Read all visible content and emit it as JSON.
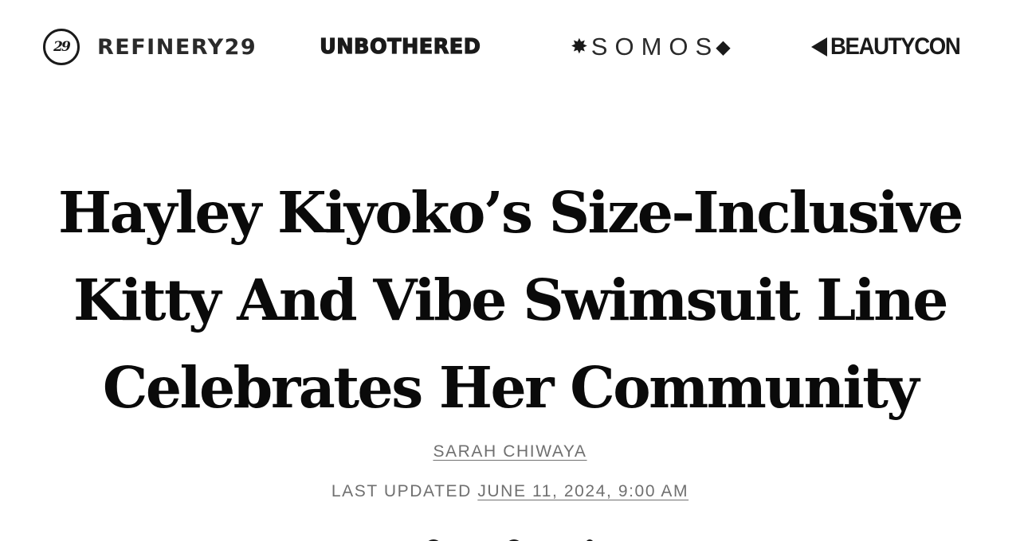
{
  "brands": {
    "refinery29": {
      "logo_text": "29",
      "name": "REFINERY29"
    },
    "unbothered": {
      "name": "UNBOTHERED"
    },
    "somos": {
      "name": "SOMOS"
    },
    "beautycon": {
      "name": "BEAUTYCON"
    }
  },
  "article": {
    "title_lines": [
      "Hayley Kiyoko’s Size-Inclusive",
      "Kitty And Vibe Swimsuit Line",
      "Celebrates Her Community"
    ],
    "author": "SARAH CHIWAYA",
    "updated_label": "LAST UPDATED",
    "updated_date": "JUNE 11, 2024, 9:00 AM"
  },
  "icons": {
    "somos_star": "asterisk-star-icon",
    "somos_diamond": "diamond-icon",
    "beautycon_mark": "beautycon-arrow-icon",
    "share": [
      "facebook-icon",
      "pinterest-icon",
      "twitter-icon"
    ]
  },
  "colors": {
    "text": "#0a0a0a",
    "meta": "#707070",
    "background": "#ffffff"
  }
}
